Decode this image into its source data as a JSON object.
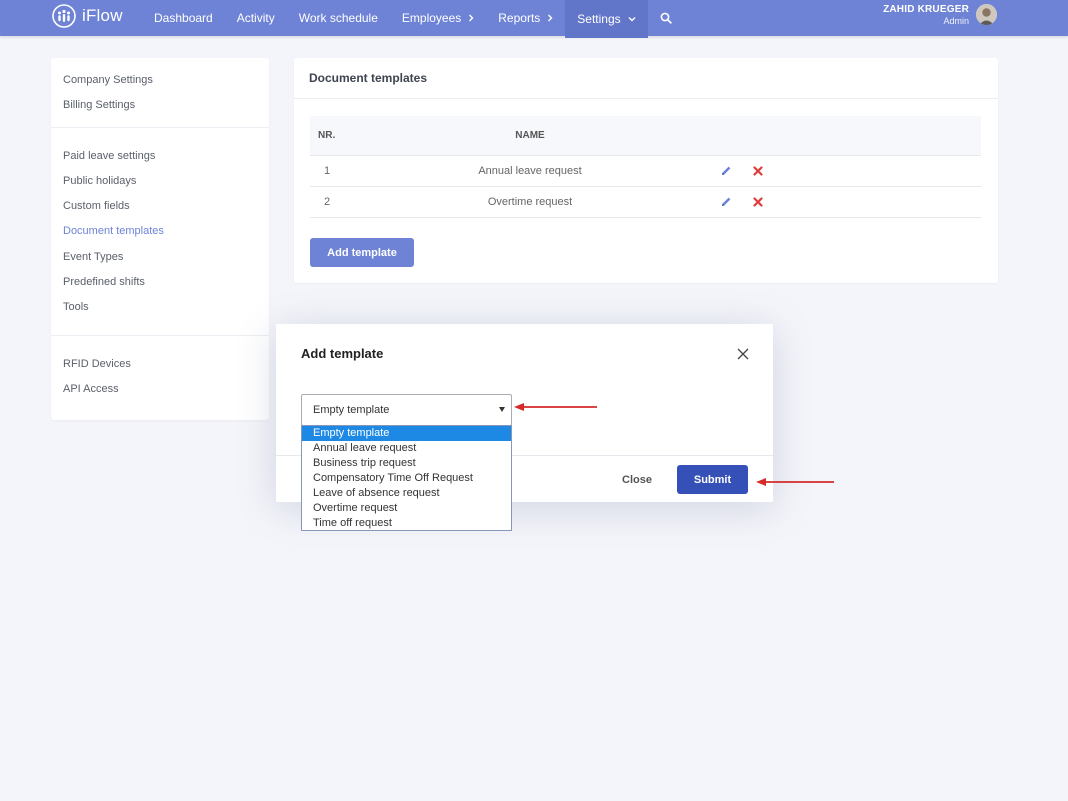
{
  "app": {
    "name": "iFlow",
    "accent": "#6e83d6",
    "submit_color": "#3551b8",
    "highlight_color": "#1e88e5",
    "annotation_color": "#d42a2a"
  },
  "nav": {
    "items": [
      {
        "label": "Dashboard",
        "icon": null
      },
      {
        "label": "Activity",
        "icon": null
      },
      {
        "label": "Work schedule",
        "icon": null
      },
      {
        "label": "Employees",
        "icon": "chevron-right-icon"
      },
      {
        "label": "Reports",
        "icon": "chevron-right-icon"
      },
      {
        "label": "Settings",
        "icon": "chevron-down-icon",
        "active": true
      }
    ],
    "search_icon": "search-icon"
  },
  "user": {
    "name": "ZAHID KRUEGER",
    "role": "Admin"
  },
  "sidebar": {
    "groups": [
      {
        "items": [
          {
            "label": "Company Settings"
          },
          {
            "label": "Billing Settings"
          }
        ]
      },
      {
        "items": [
          {
            "label": "Paid leave settings"
          },
          {
            "label": "Public holidays"
          },
          {
            "label": "Custom fields"
          },
          {
            "label": "Document templates",
            "active": true
          },
          {
            "label": "Event Types"
          },
          {
            "label": "Predefined shifts"
          },
          {
            "label": "Tools"
          }
        ]
      },
      {
        "items": [
          {
            "label": "RFID Devices"
          },
          {
            "label": "API Access"
          }
        ]
      }
    ]
  },
  "main": {
    "title": "Document templates",
    "table": {
      "headers": {
        "nr": "NR.",
        "name": "NAME"
      },
      "rows": [
        {
          "nr": "1",
          "name": "Annual leave request"
        },
        {
          "nr": "2",
          "name": "Overtime request"
        }
      ]
    },
    "add_button": "Add template"
  },
  "modal": {
    "title": "Add template",
    "select": {
      "value": "Empty template",
      "options": [
        "Empty template",
        "Annual leave request",
        "Business trip request",
        "Compensatory Time Off Request",
        "Leave of absence request",
        "Overtime request",
        "Time off request"
      ],
      "selected_index": 0
    },
    "close_label": "Close",
    "submit_label": "Submit"
  }
}
